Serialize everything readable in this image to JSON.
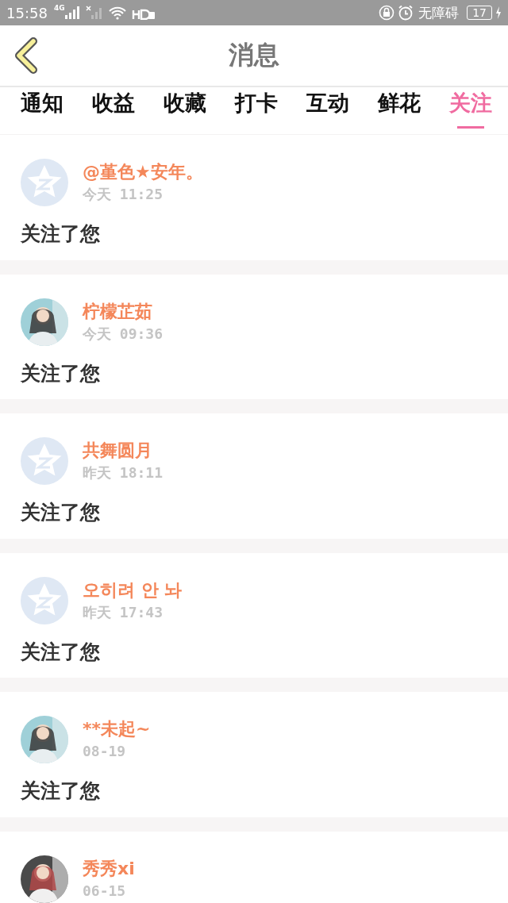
{
  "status_bar": {
    "time": "15:58",
    "network": "4G",
    "accessibility": "无障碍",
    "battery": "17"
  },
  "header": {
    "title": "消息"
  },
  "tabs": [
    {
      "label": "通知",
      "selected": false
    },
    {
      "label": "收益",
      "selected": false
    },
    {
      "label": "收藏",
      "selected": false
    },
    {
      "label": "打卡",
      "selected": false
    },
    {
      "label": "互动",
      "selected": false
    },
    {
      "label": "鲜花",
      "selected": false
    },
    {
      "label": "关注",
      "selected": true
    }
  ],
  "messages": [
    {
      "avatar": {
        "kind": "default"
      },
      "name": "@堇色★安年。",
      "time": "今天 11:25",
      "text": "关注了您"
    },
    {
      "name": "柠檬芷茹",
      "time": "今天 09:36",
      "text": "关注了您"
    },
    {
      "avatar": {
        "kind": "default"
      },
      "name": "共舞圆月",
      "time": "昨天 18:11",
      "text": "关注了您"
    },
    {
      "avatar": {
        "kind": "default"
      },
      "name": "오히려 안 놔",
      "time": "昨天 17:43",
      "text": "关注了您"
    },
    {
      "name": "**未起~",
      "time": "08-19",
      "text": "关注了您"
    },
    {
      "name": "秀秀xi",
      "time": "06-15"
    }
  ]
}
